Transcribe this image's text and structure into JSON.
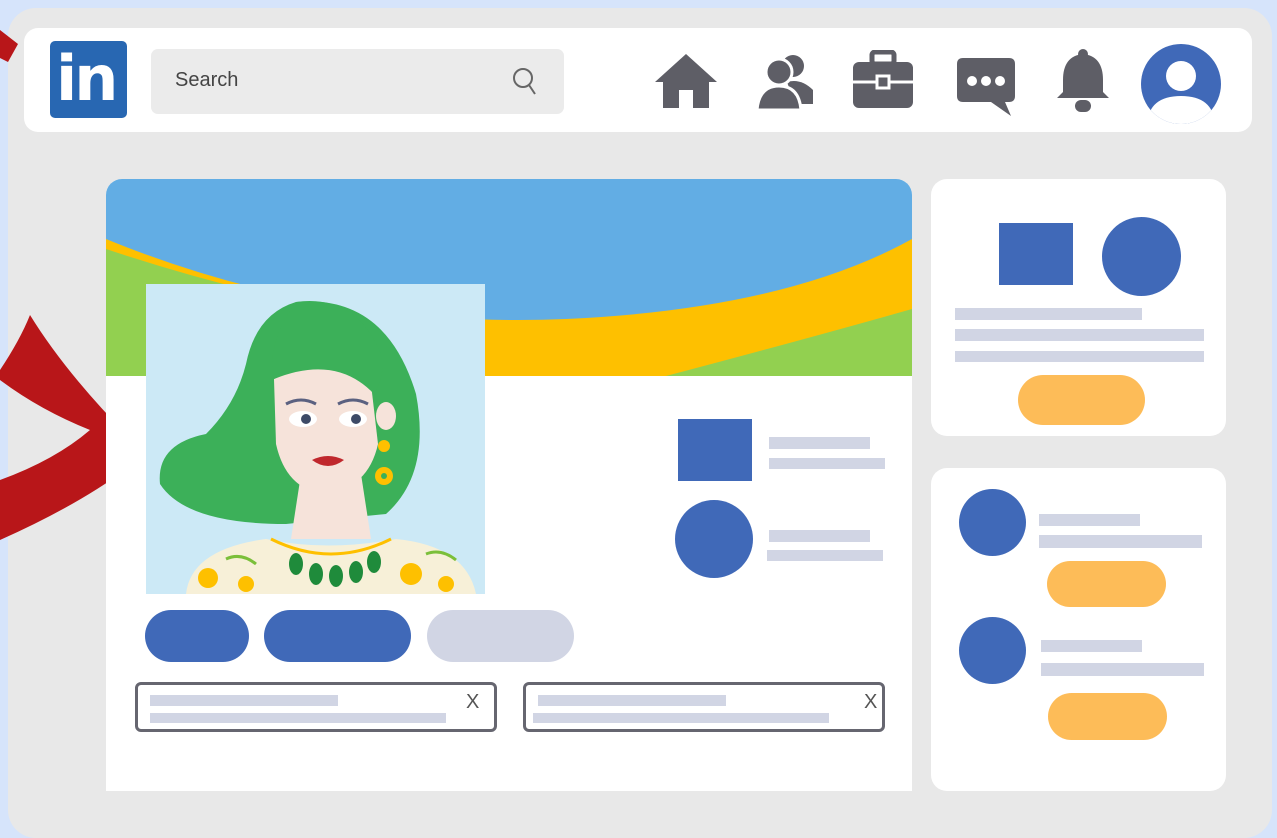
{
  "brand": {
    "logo_text": "in"
  },
  "search": {
    "placeholder": "Search"
  },
  "nav": {
    "icons": [
      "home-icon",
      "people-icon",
      "briefcase-icon",
      "messaging-icon",
      "bell-icon",
      "avatar-icon"
    ]
  },
  "notifications": [
    {
      "close_label": "X"
    },
    {
      "close_label": "X"
    }
  ],
  "colors": {
    "background": "#d6e4fb",
    "frame": "#e8e8e8",
    "brand_blue": "#2867b2",
    "accent_blue": "#4069b8",
    "placeholder_gray": "#d1d5e4",
    "action_orange": "#fdbc58",
    "banner_sky": "#62ade4",
    "banner_yellow": "#fec000",
    "banner_green": "#92d050",
    "icon_gray": "#5e5e66",
    "arrow_red": "#b81619"
  }
}
